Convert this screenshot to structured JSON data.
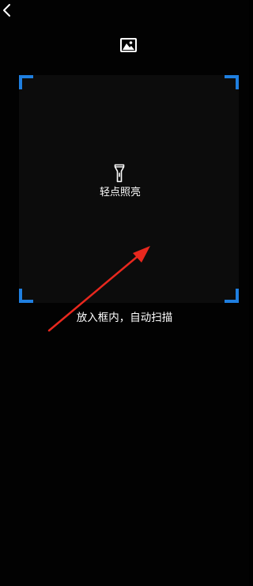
{
  "nav": {
    "back_icon": "chevron-left-icon",
    "album_icon": "image-gallery-icon"
  },
  "scanner": {
    "corner_color": "#1f7fe0",
    "torch_icon": "flashlight-icon",
    "torch_label": "轻点照亮",
    "hint": "放入框内，自动扫描"
  },
  "annotation": {
    "arrow_color": "#e8281e"
  }
}
